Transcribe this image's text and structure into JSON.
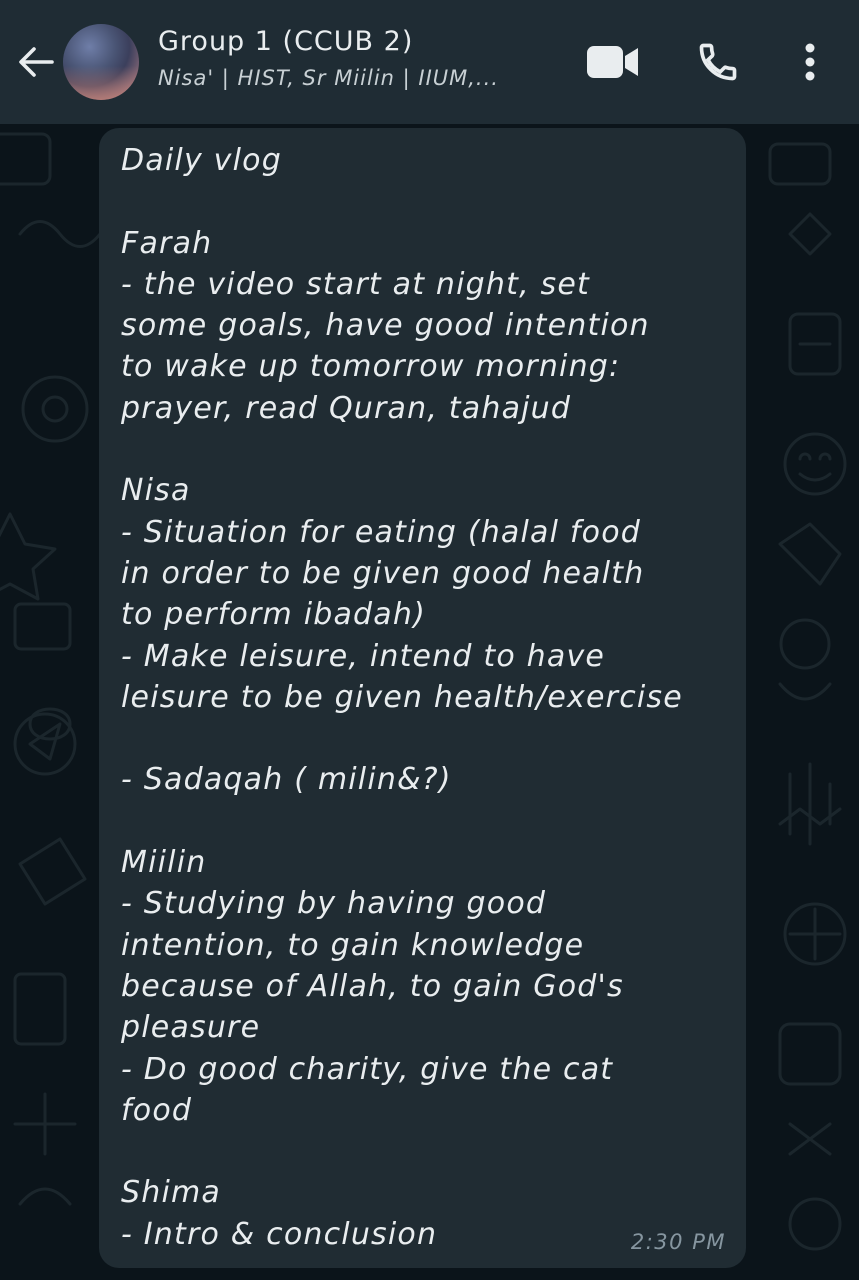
{
  "header": {
    "back_icon": "arrow-left-icon",
    "title": "Group 1 (CCUB 2)",
    "subtitle": "Nisa' | HIST, Sr Miilin | IIUM,...",
    "video_icon": "video-camera-icon",
    "call_icon": "phone-icon",
    "menu_icon": "more-vertical-icon"
  },
  "message": {
    "lines": [
      "Daily vlog",
      "",
      "Farah",
      "- the video start at night, set",
      "some goals, have good intention",
      "to wake up tomorrow morning:",
      "prayer, read Quran, tahajud",
      "",
      "Nisa",
      "- Situation for eating (halal food",
      "in order to be given good health",
      "to perform ibadah)",
      "- Make leisure, intend to have",
      "leisure to be given health/exercise",
      "",
      "- Sadaqah ( milin&?)",
      "",
      "Miilin",
      "- Studying by having good",
      "intention, to gain knowledge",
      "because of Allah, to gain God's",
      "pleasure",
      "- Do good charity, give the cat",
      "food",
      "",
      "Shima",
      "- Intro & conclusion"
    ],
    "time": "2:30 PM"
  },
  "colors": {
    "header_bg": "#1f2c34",
    "chat_bg": "#0b141a",
    "bubble_bg": "#202c33",
    "text": "#e9edef",
    "meta": "#8696a0"
  }
}
